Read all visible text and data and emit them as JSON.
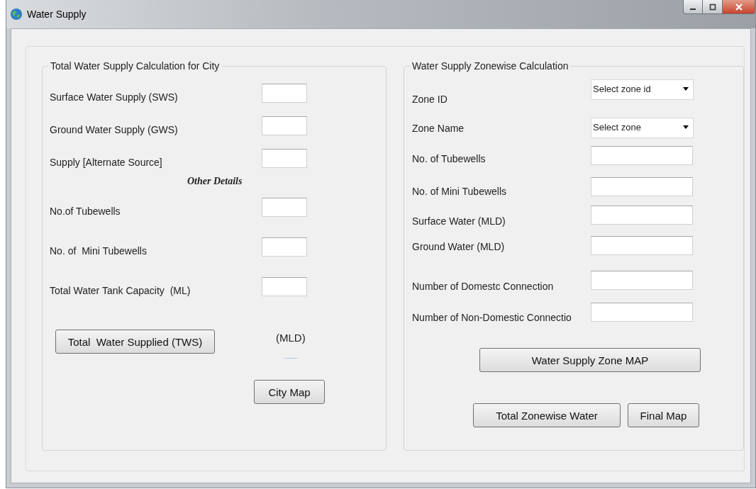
{
  "window": {
    "title": "Water Supply"
  },
  "city_group": {
    "title": "Total Water Supply Calculation for City",
    "fields": [
      {
        "label": "Surface Water Supply (SWS)"
      },
      {
        "label": "Ground Water Supply (GWS)"
      },
      {
        "label": "Supply [Alternate Source]"
      }
    ],
    "section_heading": "Other Details",
    "detail_fields": [
      {
        "label": "No.of Tubewells"
      },
      {
        "label": "No. of  Mini Tubewells"
      },
      {
        "label": "Total Water Tank Capacity  (ML)"
      }
    ],
    "total_button": "Total  Water Supplied (TWS)",
    "unit": "(MLD)",
    "map_button": "City Map"
  },
  "zone_group": {
    "title": "Water Supply Zonewise Calculation",
    "fields": [
      {
        "kind": "dropdown",
        "label": "Zone ID",
        "value": "Select zone id"
      },
      {
        "kind": "dropdown",
        "label": "Zone Name",
        "value": "Select zone"
      },
      {
        "kind": "text",
        "label": "No. of Tubewells"
      },
      {
        "kind": "text",
        "label": "No. of Mini Tubewells"
      },
      {
        "kind": "text",
        "label": "Surface Water (MLD)"
      },
      {
        "kind": "text",
        "label": "Ground Water (MLD)"
      },
      {
        "kind": "text",
        "label": "Number of Domestc Connection"
      },
      {
        "kind": "text",
        "label": "Number of Non-Domestic Connectio"
      }
    ],
    "map_button": "Water Supply Zone MAP",
    "buttons": [
      "Total Zonewise Water",
      "Final Map"
    ]
  }
}
